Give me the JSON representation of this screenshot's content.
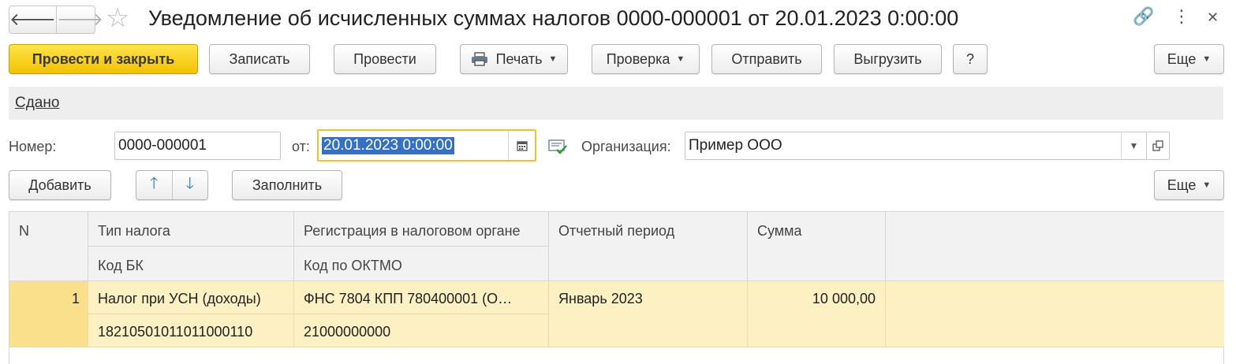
{
  "window": {
    "title": "Уведомление об исчисленных суммах налогов 0000-000001 от 20.01.2023 0:00:00",
    "nav_back": "🡐",
    "nav_forward": "🡒",
    "favorite_icon": "☆",
    "link_icon": "🔗",
    "more_icon": "⋮",
    "close_icon": "✕"
  },
  "toolbar": {
    "post_and_close": "Провести и закрыть",
    "save": "Записать",
    "post": "Провести",
    "print": "Печать",
    "check": "Проверка",
    "send": "Отправить",
    "export": "Выгрузить",
    "help": "?",
    "more": "Еще"
  },
  "status": {
    "link": "Сдано"
  },
  "form": {
    "number_label": "Номер:",
    "number_value": "0000-000001",
    "date_label": "от:",
    "date_value": "20.01.2023  0:00:00",
    "org_label": "Организация:",
    "org_value": "Пример ООО"
  },
  "table_toolbar": {
    "add": "Добавить",
    "up": "🡑",
    "down": "🡓",
    "fill": "Заполнить",
    "more": "Еще"
  },
  "table": {
    "headers": {
      "n": "N",
      "tax_type": "Тип налога",
      "kbk": "Код БК",
      "registration": "Регистрация в налоговом органе",
      "oktmo": "Код по ОКТМО",
      "period": "Отчетный период",
      "sum": "Сумма"
    },
    "rows": [
      {
        "n": "1",
        "tax_type": "Налог при УСН (доходы)",
        "kbk": "18210501011011000110",
        "registration": "ФНС 7804 КПП 780400001 (О…",
        "oktmo": "21000000000",
        "period": "Январь 2023",
        "sum": "10 000,00"
      }
    ]
  },
  "colors": {
    "primary_button": "#f5c800",
    "selected_row": "#fdf1c4",
    "row_number_cell": "#fbe08c",
    "date_focus_border": "#f0c229",
    "date_selection": "#3470c6"
  }
}
